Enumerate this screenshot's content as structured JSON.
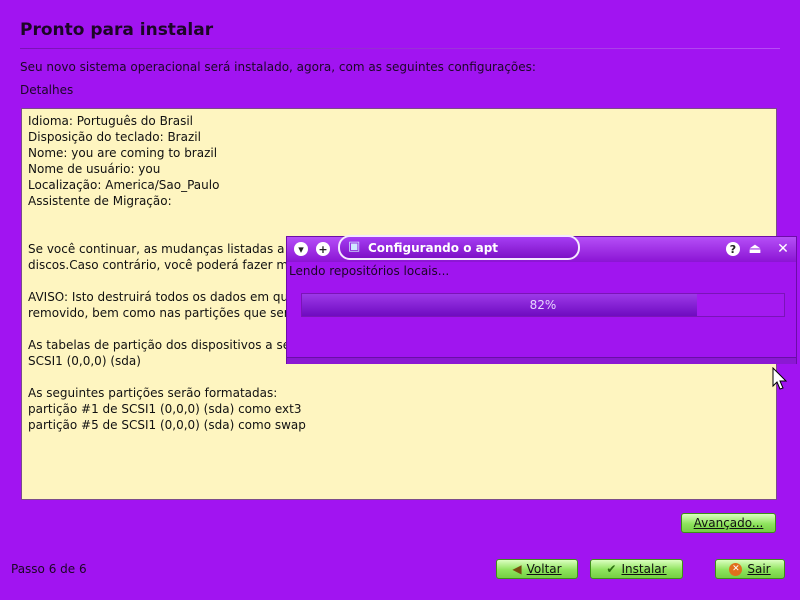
{
  "header": {
    "title": "Pronto para instalar",
    "subtitle": "Seu novo sistema operacional será instalado, agora, com as seguintes configurações:",
    "details_label": "Detalhes"
  },
  "summary": {
    "lines": [
      "Idioma: Português do Brasil",
      "Disposição do teclado: Brazil",
      "Nome: you are coming to brazil",
      "Nome de usuário: you",
      "Localização: America/Sao_Paulo",
      "Assistente de Migração:",
      "",
      "",
      "Se você continuar, as mudanças listadas a",
      "discos.Caso contrário, você poderá fazer m",
      "",
      "AVISO: Isto destruirá todos os dados em qu",
      "removido, bem como nas partições que ser",
      "",
      "As tabelas de partição dos dispositivos a seg",
      "SCSI1 (0,0,0) (sda)",
      "",
      "As seguintes partições serão formatadas:",
      "partição #1 de SCSI1 (0,0,0) (sda) como ext3",
      "partição #5 de SCSI1 (0,0,0) (sda) como swap"
    ]
  },
  "buttons": {
    "advanced": "Avançado...",
    "back": "Voltar",
    "install": "Instalar",
    "quit": "Sair"
  },
  "footer": {
    "step": "Passo 6 de 6"
  },
  "progress_dialog": {
    "title": "Configurando o apt",
    "status": "Lendo repositórios locais...",
    "percent_label": "82%",
    "progress_fraction": 0.82
  },
  "colors": {
    "background": "#a114f1",
    "summary_bg": "#fef5c0",
    "button_green": "#8ee35d"
  }
}
